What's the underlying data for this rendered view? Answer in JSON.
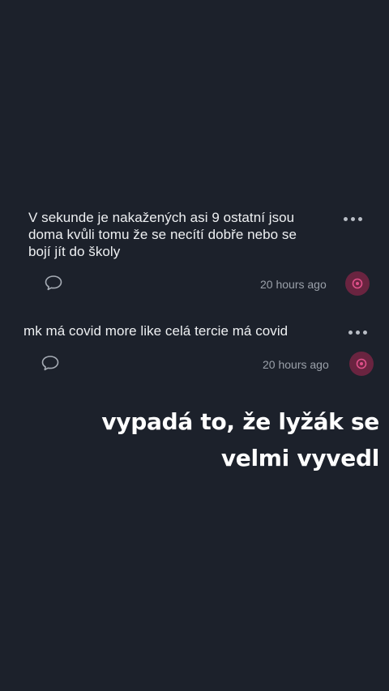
{
  "posts": [
    {
      "text_lines": [
        "V sekunde je nakažených asi 9 ostatní jsou",
        "doma kvůli tomu že se necítí dobře nebo se",
        "bojí jít do školy"
      ],
      "timestamp": "20 hours ago",
      "icons": {
        "more": "more-options-icon",
        "comment": "comment-icon",
        "badge": "user-badge-icon"
      }
    },
    {
      "text_lines": [
        "mk má covid more like celá tercie má covid"
      ],
      "timestamp": "20 hours ago",
      "icons": {
        "more": "more-options-icon",
        "comment": "comment-icon",
        "badge": "user-badge-icon"
      }
    }
  ],
  "caption": {
    "lines": [
      "vypadá to, že lyžák se",
      "velmi vyvedl"
    ]
  },
  "colors": {
    "background": "#1c212b",
    "badge": "#6a2440",
    "badge_glyph": "#e0508a"
  }
}
